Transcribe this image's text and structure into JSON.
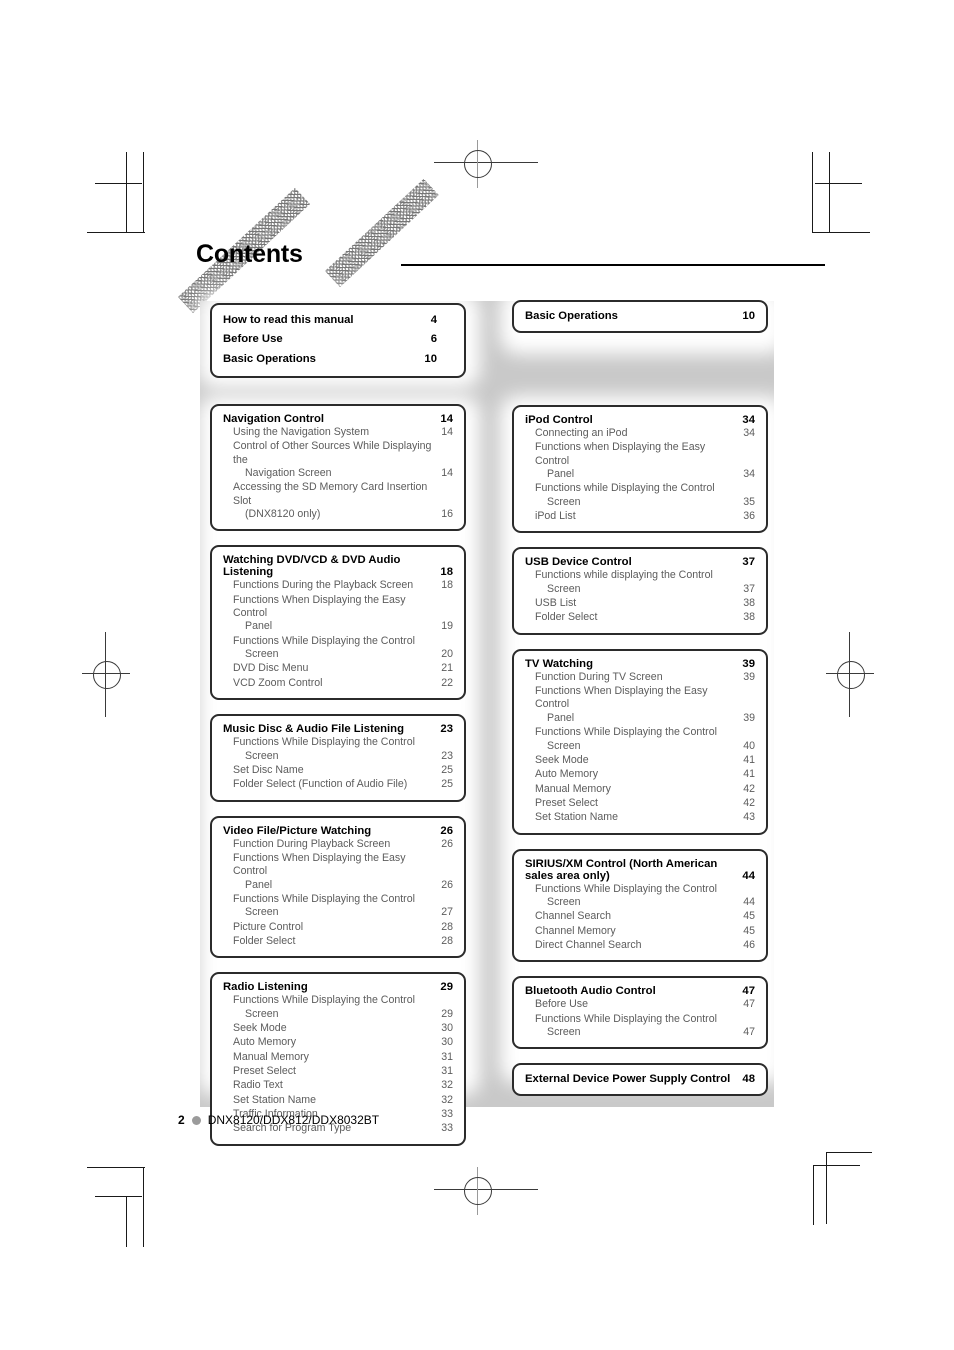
{
  "page": {
    "title": "Contents",
    "footer_number": "2",
    "footer_models": "DNX8120/DDX812/DDX8032BT",
    "gray_hex": "#c9c9c9",
    "sub_text_hex": "#5c5c5c"
  },
  "summary_box": {
    "rows": [
      {
        "label": "How to read this manual",
        "page": "4"
      },
      {
        "label": "Before Use",
        "page": "6"
      },
      {
        "label": "Basic Operations",
        "page": "10"
      }
    ]
  },
  "right_top_box": {
    "title": "Basic Operations",
    "page": "10"
  },
  "left_column": [
    {
      "title": "Navigation Control",
      "page": "14",
      "items": [
        {
          "text": "Using the Navigation System",
          "cont": "",
          "page": "14"
        },
        {
          "text": "Control of Other Sources While Displaying the",
          "cont": "Navigation Screen",
          "page": "14"
        },
        {
          "text": "Accessing the SD Memory Card Insertion Slot",
          "cont": "(DNX8120 only)",
          "page": "16"
        }
      ]
    },
    {
      "title": "Watching DVD/VCD & DVD Audio",
      "title_line2": "Listening",
      "page": "18",
      "items": [
        {
          "text": "Functions During the Playback Screen",
          "cont": "",
          "page": "18"
        },
        {
          "text": "Functions When Displaying the Easy Control",
          "cont": "Panel",
          "page": "19"
        },
        {
          "text": "Functions While Displaying the Control",
          "cont": "Screen",
          "page": "20"
        },
        {
          "text": "DVD Disc Menu",
          "cont": "",
          "page": "21"
        },
        {
          "text": "VCD Zoom Control",
          "cont": "",
          "page": "22"
        }
      ]
    },
    {
      "title": "Music Disc & Audio File Listening",
      "page": "23",
      "items": [
        {
          "text": "Functions While Displaying the Control",
          "cont": "Screen",
          "page": "23"
        },
        {
          "text": "Set Disc Name",
          "cont": "",
          "page": "25"
        },
        {
          "text": "Folder Select (Function of Audio File)",
          "cont": "",
          "page": "25"
        }
      ]
    },
    {
      "title": "Video File/Picture Watching",
      "page": "26",
      "items": [
        {
          "text": "Function During Playback Screen",
          "cont": "",
          "page": "26"
        },
        {
          "text": "Functions When Displaying the Easy Control",
          "cont": "Panel",
          "page": "26"
        },
        {
          "text": "Functions While Displaying the Control",
          "cont": "Screen",
          "page": "27"
        },
        {
          "text": "Picture Control",
          "cont": "",
          "page": "28"
        },
        {
          "text": "Folder Select",
          "cont": "",
          "page": "28"
        }
      ]
    },
    {
      "title": "Radio Listening",
      "page": "29",
      "items": [
        {
          "text": "Functions While Displaying the Control",
          "cont": "Screen",
          "page": "29"
        },
        {
          "text": "Seek Mode",
          "cont": "",
          "page": "30"
        },
        {
          "text": "Auto Memory",
          "cont": "",
          "page": "30"
        },
        {
          "text": "Manual Memory",
          "cont": "",
          "page": "31"
        },
        {
          "text": "Preset Select",
          "cont": "",
          "page": "31"
        },
        {
          "text": "Radio Text",
          "cont": "",
          "page": "32"
        },
        {
          "text": "Set Station Name",
          "cont": "",
          "page": "32"
        },
        {
          "text": "Traffic Information",
          "cont": "",
          "page": "33"
        },
        {
          "text": "Search for Program Type",
          "cont": "",
          "page": "33"
        }
      ]
    }
  ],
  "right_column": [
    {
      "title": "iPod Control",
      "page": "34",
      "items": [
        {
          "text": "Connecting an iPod",
          "cont": "",
          "page": "34"
        },
        {
          "text": "Functions when Displaying the Easy Control",
          "cont": "Panel",
          "page": "34"
        },
        {
          "text": "Functions while Displaying the Control",
          "cont": "Screen",
          "page": "35"
        },
        {
          "text": "iPod List",
          "cont": "",
          "page": "36"
        }
      ]
    },
    {
      "title": "USB Device Control",
      "page": "37",
      "items": [
        {
          "text": "Functions while displaying the Control",
          "cont": "Screen",
          "page": "37"
        },
        {
          "text": "USB List",
          "cont": "",
          "page": "38"
        },
        {
          "text": "Folder Select",
          "cont": "",
          "page": "38"
        }
      ]
    },
    {
      "title": "TV Watching",
      "page": "39",
      "items": [
        {
          "text": "Function During TV Screen",
          "cont": "",
          "page": "39"
        },
        {
          "text": "Functions When Displaying the Easy Control",
          "cont": "Panel",
          "page": "39"
        },
        {
          "text": "Functions While Displaying the Control",
          "cont": "Screen",
          "page": "40"
        },
        {
          "text": "Seek Mode",
          "cont": "",
          "page": "41"
        },
        {
          "text": "Auto Memory",
          "cont": "",
          "page": "41"
        },
        {
          "text": "Manual Memory",
          "cont": "",
          "page": "42"
        },
        {
          "text": "Preset Select",
          "cont": "",
          "page": "42"
        },
        {
          "text": "Set Station Name",
          "cont": "",
          "page": "43"
        }
      ]
    },
    {
      "title": "SIRIUS/XM Control (North American",
      "title_line2": "sales area only)",
      "page": "44",
      "items": [
        {
          "text": "Functions While Displaying the Control",
          "cont": "Screen",
          "page": "44"
        },
        {
          "text": "Channel Search",
          "cont": "",
          "page": "45"
        },
        {
          "text": "Channel Memory",
          "cont": "",
          "page": "45"
        },
        {
          "text": "Direct Channel Search",
          "cont": "",
          "page": "46"
        }
      ]
    },
    {
      "title": "Bluetooth Audio Control",
      "page": "47",
      "items": [
        {
          "text": "Before Use",
          "cont": "",
          "page": "47"
        },
        {
          "text": "Functions While Displaying the Control",
          "cont": "Screen",
          "page": "47"
        }
      ]
    },
    {
      "title": "External Device Power Supply Control",
      "page": "48",
      "items": []
    }
  ]
}
